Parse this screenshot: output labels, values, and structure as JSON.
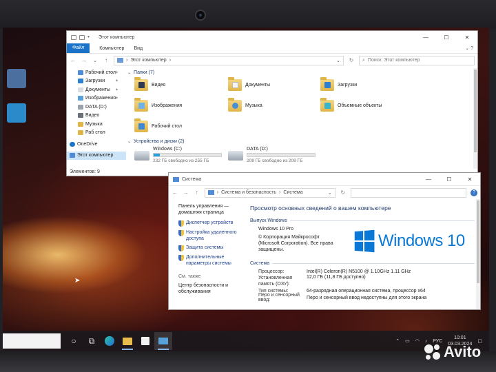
{
  "explorer": {
    "title": "Этот компьютер",
    "ribbon_tabs": [
      "Файл",
      "Компьютер",
      "Вид"
    ],
    "address": "Этот компьютер",
    "search_placeholder": "Поиск: Этот компьютер",
    "sidebar_items": [
      {
        "label": "Рабочий стол",
        "pinned": true
      },
      {
        "label": "Загрузки",
        "pinned": true
      },
      {
        "label": "Документы",
        "pinned": true
      },
      {
        "label": "Изображения",
        "pinned": true
      },
      {
        "label": "DATA (D:)",
        "pinned": false
      },
      {
        "label": "Видео",
        "pinned": false
      },
      {
        "label": "Музыка",
        "pinned": false
      },
      {
        "label": "Раб стол",
        "pinned": false
      },
      {
        "label": "OneDrive",
        "pinned": false
      },
      {
        "label": "Этот компьютер",
        "pinned": false
      }
    ],
    "folders_header": "Папки (7)",
    "folders": [
      "Видео",
      "Документы",
      "Загрузки",
      "Изображения",
      "Музыка",
      "Объемные объекты",
      "Рабочий стол"
    ],
    "drives_header": "Устройства и диски (2)",
    "drives": [
      {
        "name": "Windows (C:)",
        "free": "232 ГБ свободно из 255 ГБ",
        "used_fraction": 0.09
      },
      {
        "name": "DATA (D:)",
        "free": "208 ГБ свободно из 208 ГБ",
        "used_fraction": 0.0
      }
    ],
    "status": "Элементов: 9"
  },
  "system": {
    "title": "Система",
    "breadcrumb": [
      "Система и безопасность",
      "Система"
    ],
    "left_links": {
      "home": "Панель управления — домашняя страница",
      "device_manager": "Диспетчер устройств",
      "remote": "Настройка удаленного доступа",
      "protection": "Защита системы",
      "advanced": "Дополнительные параметры системы",
      "see_also": "См. также",
      "security_center": "Центр безопасности и обслуживания"
    },
    "heading": "Просмотр основных сведений о вашем компьютере",
    "edition_header": "Выпуск Windows",
    "edition": "Windows 10 Pro",
    "copyright": "© Корпорация Майкрософт (Microsoft Corporation). Все права защищены.",
    "logo_text": "Windows 10",
    "system_header": "Система",
    "specs": [
      {
        "k": "Процессор:",
        "v": "Intel(R) Celeron(R) N5100 @ 1.10GHz   1.11 GHz"
      },
      {
        "k": "Установленная память (ОЗУ):",
        "v": "12,0 ГБ (11,8 ГБ доступно)"
      },
      {
        "k": "Тип системы:",
        "v": "64-разрядная операционная система, процессор x64"
      },
      {
        "k": "Перо и сенсорный ввод:",
        "v": "Перо и сенсорный ввод недоступны для этого экрана"
      }
    ]
  },
  "taskbar": {
    "lang": "РУС",
    "time": "10:01",
    "date": "03.03.2024"
  },
  "watermark": "Avito",
  "colors": {
    "accent": "#1a73c9",
    "win_blue": "#0a78d7",
    "link": "#1c3f8c"
  }
}
